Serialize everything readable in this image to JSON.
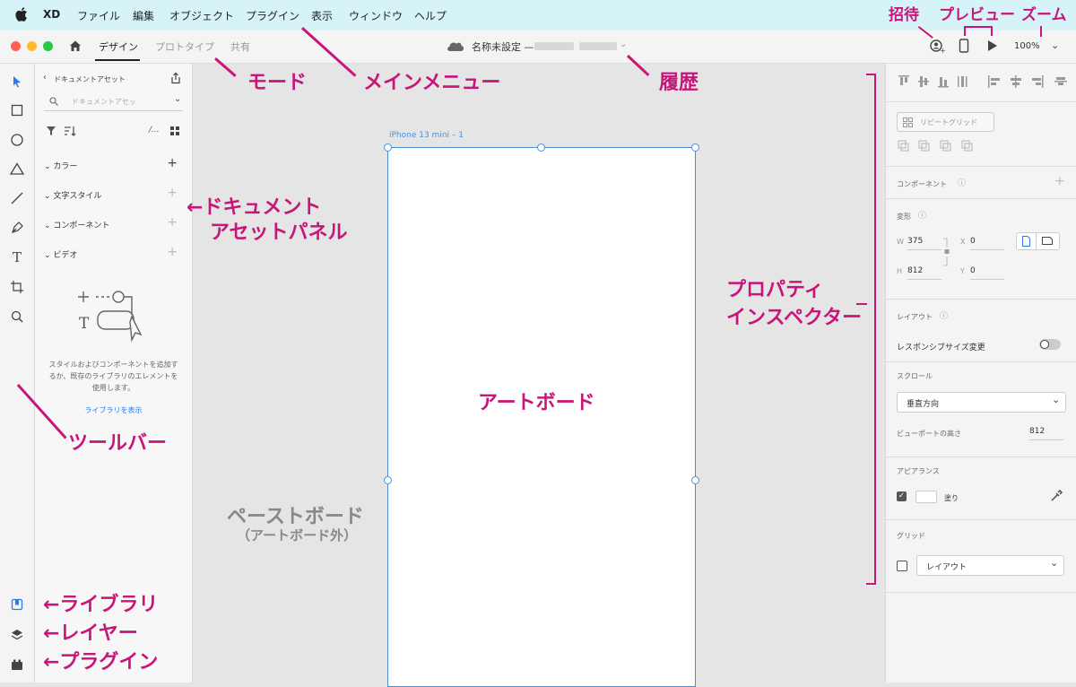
{
  "menubar": {
    "app_name": "XD",
    "items": [
      "ファイル",
      "編集",
      "オブジェクト",
      "プラグイン",
      "表示",
      "ウィンドウ",
      "ヘルプ"
    ]
  },
  "titlebar": {
    "tabs": [
      "デザイン",
      "プロトタイプ",
      "共有"
    ],
    "doc_title": "名称未設定 —",
    "zoom": "100%"
  },
  "assets": {
    "back_label": "ドキュメントアセット",
    "search_placeholder": "ドキュメントアセッ",
    "sections": [
      "カラー",
      "文字スタイル",
      "コンポーネント",
      "ビデオ"
    ],
    "empty_text_1": "スタイルおよびコンポーネントを追加す",
    "empty_text_2": "るか、既存のライブラリのエレメントを",
    "empty_text_3": "使用します。",
    "library_link": "ライブラリを表示"
  },
  "canvas": {
    "artboard_name": "iPhone 13 mini – 1",
    "artboard_label": "アートボード",
    "pasteboard_label": "ペーストボード",
    "pasteboard_sub": "（アートボード外）"
  },
  "inspector": {
    "repeat_grid": "リピートグリッド",
    "component": "コンポーネント",
    "transform": "変形",
    "w_label": "W",
    "w_value": "375",
    "h_label": "H",
    "h_value": "812",
    "x_label": "X",
    "x_value": "0",
    "y_label": "Y",
    "y_value": "0",
    "layout": "レイアウト",
    "responsive": "レスポンシブサイズ変更",
    "scroll": "スクロール",
    "scroll_value": "垂直方向",
    "viewport_label": "ビューポートの高さ",
    "viewport_value": "812",
    "appearance": "アピアランス",
    "fill": "塗り",
    "grid": "グリッド",
    "grid_value": "レイアウト"
  },
  "annotations": {
    "invite": "招待",
    "preview": "プレビュー",
    "zoom": "ズーム",
    "mode": "モード",
    "main_menu": "メインメニュー",
    "history": "履歴",
    "asset_panel_1": "←ドキュメント",
    "asset_panel_2": "アセットパネル",
    "inspector_1": "プロパティ",
    "inspector_2": "インスペクター",
    "toolbar": "ツールバー",
    "library": "←ライブラリ",
    "layers": "←レイヤー",
    "plugins": "←プラグイン"
  },
  "colors": {
    "menubar_bg": "#d6f4f8",
    "annotation": "#c8157a",
    "selection": "#4a90d9"
  }
}
